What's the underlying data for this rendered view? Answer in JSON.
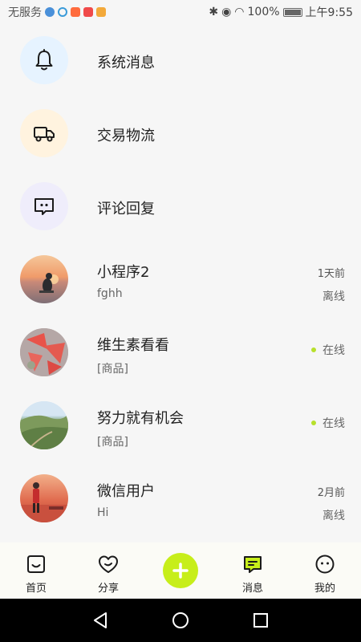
{
  "status_bar": {
    "carrier": "无服务",
    "battery": "100%",
    "time": "上午9:55"
  },
  "system_items": [
    {
      "title": "系统消息",
      "icon": "bell-icon",
      "bg": "#e6f3ff"
    },
    {
      "title": "交易物流",
      "icon": "truck-icon",
      "bg": "#fff3df"
    },
    {
      "title": "评论回复",
      "icon": "comment-icon",
      "bg": "#efedfb"
    }
  ],
  "conversations": [
    {
      "name": "小程序2",
      "preview": "fghh",
      "time": "1天前",
      "status": "离线",
      "online": false
    },
    {
      "name": "维生素看看",
      "preview": "[商品]",
      "time": "",
      "status": "在线",
      "online": true
    },
    {
      "name": "努力就有机会",
      "preview": "[商品]",
      "time": "",
      "status": "在线",
      "online": true
    },
    {
      "name": "微信用户",
      "preview": "Hi",
      "time": "2月前",
      "status": "离线",
      "online": false
    }
  ],
  "bottom_nav": {
    "home": "首页",
    "share": "分享",
    "messages": "消息",
    "mine": "我的"
  },
  "colors": {
    "accent": "#c7ee1a",
    "online": "#b7e02b"
  }
}
